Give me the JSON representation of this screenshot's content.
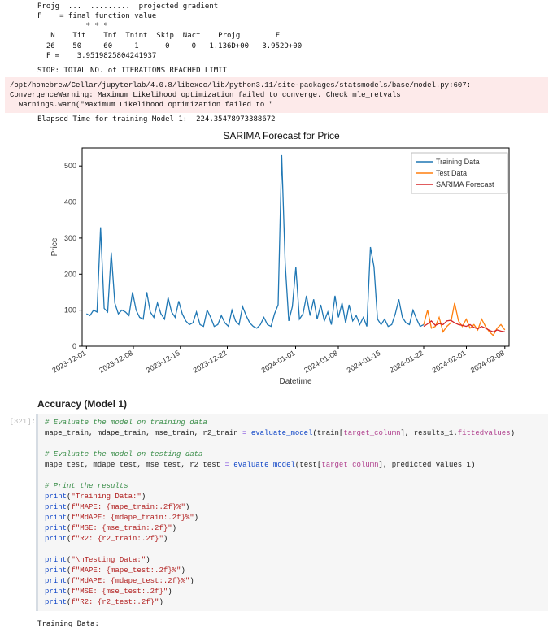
{
  "output_top": {
    "line1": "Projg  ...  .........  projected gradient",
    "line2": "F    = final function value",
    "stars": "           * * *",
    "hdr": "   N    Tit    Tnf  Tnint  Skip  Nact    Projg        F",
    "vals": "  26    50     60     1      0     0   1.136D+00   3.952D+00",
    "fval": "  F =    3.9519825804241937",
    "stop": "STOP: TOTAL NO. of ITERATIONS REACHED LIMIT"
  },
  "warning": "/opt/homebrew/Cellar/jupyterlab/4.0.8/libexec/lib/python3.11/site-packages/statsmodels/base/model.py:607: ConvergenceWarning: Maximum Likelihood optimization failed to converge. Check mle_retvals\n  warnings.warn(\"Maximum Likelihood optimization failed to \"",
  "elapsed": "Elapsed Time for training Model 1:  224.35478973388672",
  "section_accuracy": "Accuracy (Model 1)",
  "cell_prompt": "[321]:",
  "code_lines": [
    {
      "t": "cmt",
      "s": "# Evaluate the model on training data"
    },
    {
      "t": "eval",
      "lhs": "mape_train, mdape_train, mse_train, r2_train",
      "fn": "evaluate_model",
      "arg1": "train",
      "col": "target_column",
      "arg2": "results_1",
      "attr": "fittedvalues"
    },
    {
      "t": "blank"
    },
    {
      "t": "cmt",
      "s": "# Evaluate the model on testing data"
    },
    {
      "t": "eval",
      "lhs": "mape_test, mdape_test, mse_test, r2_test",
      "fn": "evaluate_model",
      "arg1": "test",
      "col": "target_column",
      "arg2": "predicted_values_1",
      "attr": ""
    },
    {
      "t": "blank"
    },
    {
      "t": "cmt",
      "s": "# Print the results"
    },
    {
      "t": "print_s",
      "s": "\"Training Data:\""
    },
    {
      "t": "print_f",
      "s": "f\"MAPE: {mape_train:.2f}%\""
    },
    {
      "t": "print_f",
      "s": "f\"MdAPE: {mdape_train:.2f}%\""
    },
    {
      "t": "print_f",
      "s": "f\"MSE: {mse_train:.2f}\""
    },
    {
      "t": "print_f",
      "s": "f\"R2: {r2_train:.2f}\""
    },
    {
      "t": "blank"
    },
    {
      "t": "print_s",
      "s": "\"\\nTesting Data:\""
    },
    {
      "t": "print_f",
      "s": "f\"MAPE: {mape_test:.2f}%\""
    },
    {
      "t": "print_f",
      "s": "f\"MdAPE: {mdape_test:.2f}%\""
    },
    {
      "t": "print_f",
      "s": "f\"MSE: {mse_test:.2f}\""
    },
    {
      "t": "print_f",
      "s": "f\"R2: {r2_test:.2f}\""
    },
    {
      "t": "blank"
    }
  ],
  "out_line": "Training Data:",
  "chart_data": {
    "type": "line",
    "title": "SARIMA Forecast for Price",
    "xlabel": "Datetime",
    "ylabel": "Price",
    "ylim": [
      0,
      550
    ],
    "y_ticks": [
      0,
      100,
      200,
      300,
      400,
      500
    ],
    "x_ticks": [
      "2023-12-01",
      "2023-12-08",
      "2023-12-15",
      "2023-12-22",
      "2024-01-01",
      "2024-01-08",
      "2024-01-15",
      "2024-01-22",
      "2024-02-01",
      "2024-02-08"
    ],
    "x_tick_pos": [
      0.01,
      0.12,
      0.23,
      0.34,
      0.5,
      0.6,
      0.7,
      0.8,
      0.9,
      0.99
    ],
    "legend": [
      "Training Data",
      "Test Data",
      "SARIMA Forecast"
    ],
    "legend_colors": [
      "#1f77b4",
      "#ff7f0e",
      "#d62728"
    ],
    "series": [
      {
        "name": "Training Data",
        "color": "#1f77b4",
        "x_range": [
          0.01,
          0.8
        ],
        "y": [
          90,
          85,
          100,
          95,
          330,
          105,
          95,
          260,
          120,
          90,
          100,
          95,
          85,
          150,
          100,
          80,
          75,
          150,
          95,
          80,
          120,
          90,
          75,
          135,
          95,
          80,
          125,
          90,
          70,
          60,
          65,
          95,
          60,
          55,
          100,
          80,
          55,
          60,
          85,
          65,
          55,
          100,
          70,
          60,
          110,
          85,
          65,
          55,
          50,
          60,
          80,
          60,
          55,
          90,
          115,
          530,
          230,
          70,
          110,
          220,
          75,
          90,
          140,
          85,
          130,
          75,
          115,
          70,
          95,
          60,
          140,
          80,
          120,
          65,
          115,
          70,
          85,
          60,
          80,
          55,
          275,
          220,
          75,
          60,
          75,
          55,
          60,
          90,
          130,
          80,
          65,
          60,
          100,
          75,
          55,
          60
        ]
      },
      {
        "name": "Test Data",
        "color": "#ff7f0e",
        "x_range": [
          0.8,
          0.99
        ],
        "y": [
          60,
          100,
          50,
          55,
          80,
          40,
          55,
          65,
          120,
          70,
          55,
          75,
          50,
          60,
          45,
          75,
          55,
          40,
          30,
          50,
          60,
          45
        ]
      },
      {
        "name": "SARIMA Forecast",
        "color": "#d62728",
        "x_range": [
          0.8,
          0.99
        ],
        "y": [
          55,
          62,
          70,
          58,
          63,
          60,
          70,
          72,
          65,
          60,
          58,
          55,
          60,
          52,
          48,
          55,
          50,
          44,
          40,
          45,
          42,
          40
        ]
      }
    ]
  }
}
